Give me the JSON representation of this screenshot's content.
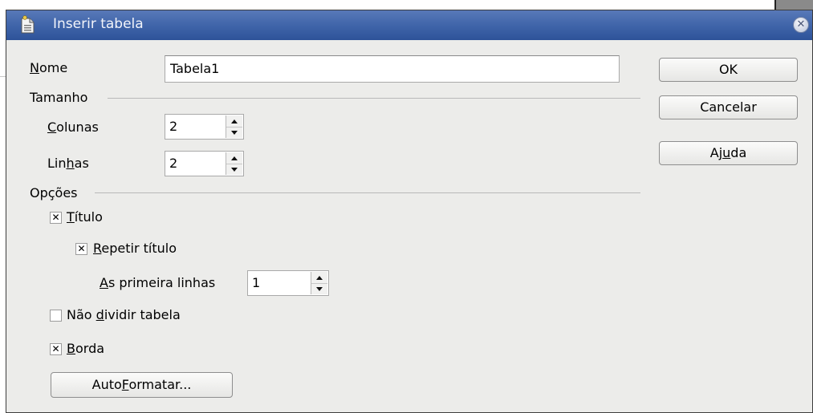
{
  "dialog": {
    "title": "Inserir tabela",
    "close_icon": "close-icon"
  },
  "name": {
    "label_underlined": "N",
    "label_rest": "ome",
    "value": "Tabela1"
  },
  "size_group": {
    "title": "Tamanho",
    "columns": {
      "label_underlined": "C",
      "label_rest": "olunas",
      "value": "2"
    },
    "rows": {
      "label_pre": "Lin",
      "label_underlined": "h",
      "label_post": "as",
      "value": "2"
    }
  },
  "options_group": {
    "title": "Opções",
    "heading": {
      "label_underlined": "T",
      "label_rest": "ítulo",
      "checked": true,
      "mark": "✕"
    },
    "repeat_heading": {
      "label_underlined": "R",
      "label_rest": "epetir título",
      "checked": true,
      "mark": "✕"
    },
    "first_rows": {
      "label_underlined": "A",
      "label_rest": "s primeira linhas",
      "value": "1"
    },
    "dont_split": {
      "label_pre": "Não ",
      "label_underlined": "d",
      "label_post": "ividir tabela",
      "checked": false,
      "mark": ""
    },
    "border": {
      "label_underlined": "B",
      "label_rest": "orda",
      "checked": true,
      "mark": "✕"
    },
    "autoformat": {
      "label_pre": "Auto",
      "label_underlined": "F",
      "label_post": "ormatar..."
    }
  },
  "buttons": {
    "ok": "OK",
    "cancel": "Cancelar",
    "help_pre": "Aj",
    "help_underlined": "u",
    "help_post": "da"
  }
}
